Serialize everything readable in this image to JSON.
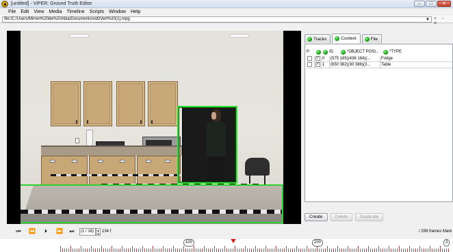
{
  "window": {
    "title": "[untitled] - ViPER: Ground Truth Editor",
    "controls": [
      "–",
      "□",
      "✕"
    ]
  },
  "menu": [
    "File",
    "Edit",
    "View",
    "Media",
    "Timeline",
    "Scripts",
    "Window",
    "Help"
  ],
  "file_path": "file:/C:/Users/Mirren%20de%20Abia/Documents/vid2Vert%20(1).mpg",
  "path_controls": "+ - ≡",
  "tabs": [
    {
      "label": "Tracks",
      "active": false
    },
    {
      "label": "Context",
      "active": true
    },
    {
      "label": "File",
      "active": false
    }
  ],
  "table": {
    "headers": [
      "P",
      "ID",
      "*OBJECT POSI...",
      "*TYPE"
    ],
    "rows": [
      {
        "p": false,
        "visible": true,
        "id": "0",
        "position": "(575 185)(438 184)(...",
        "type": "Fridge"
      },
      {
        "p": false,
        "visible": true,
        "id": "1",
        "position": "(650 382)(30 386)(3...",
        "type": "Table"
      }
    ]
  },
  "buttons": {
    "create": "Create",
    "delete": "Delete",
    "duplicate": "Duplicate"
  },
  "transport": {
    "frame_box": "(1 / 16)",
    "frame_value": "134 f",
    "total": "/ 299 frames Mark"
  },
  "timeline": {
    "markers": [
      "100",
      "200",
      "3"
    ],
    "playhead_frame": 134
  },
  "colors": {
    "bbox": "#2ed02e",
    "status_dot": "#17a517",
    "playhead": "#e01414"
  }
}
